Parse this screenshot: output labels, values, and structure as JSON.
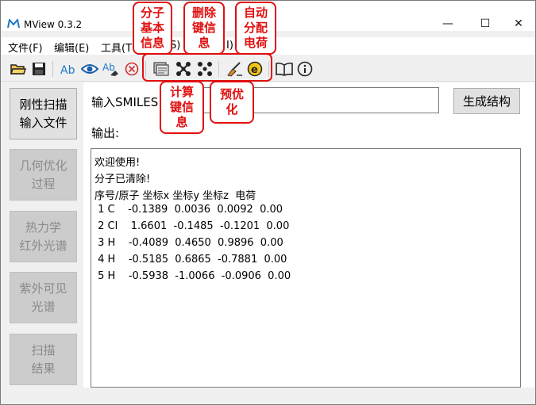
{
  "window": {
    "title": "MView 0.3.2"
  },
  "window_controls": {
    "minimize": "—",
    "maximize": "☐",
    "close": "✕"
  },
  "menu": [
    {
      "label": "文件(F)"
    },
    {
      "label": "编辑(E)"
    },
    {
      "label": "工具(T"
    },
    {
      "label": "S)"
    },
    {
      "label": "I)"
    }
  ],
  "toolbar": {
    "icons": [
      "open-folder-icon",
      "save-icon",
      "atom-label-icon",
      "view-eye-icon",
      "erase-label-icon",
      "clear-icon",
      "molecule-info-icon",
      "delete-bond-info-icon",
      "bond-calc-icon",
      "preoptimize-icon",
      "auto-charge-icon",
      "manual-book-icon",
      "info-icon"
    ]
  },
  "annotations": {
    "molecule_info": "分子\n基本\n信息",
    "delete_bond": "删除\n键信\n息",
    "auto_charge": "自动\n分配\n电荷",
    "calc_bond": "计算\n键信\n息",
    "preoptimize": "预优\n化"
  },
  "sidebar": {
    "buttons": [
      {
        "label": "刚性扫描\n输入文件",
        "enabled": true
      },
      {
        "label": "几何优化\n过程",
        "enabled": false
      },
      {
        "label": "热力学\n红外光谱",
        "enabled": false
      },
      {
        "label": "紫外可见\n光谱",
        "enabled": false
      },
      {
        "label": "扫描\n结果",
        "enabled": false
      }
    ]
  },
  "smiles": {
    "label": "输入SMILES",
    "partial": "C",
    "value": ""
  },
  "generate_button": "生成结构",
  "output": {
    "label": "输出:",
    "lines": [
      "欢迎使用!",
      "分子已清除!",
      "序号/原子 坐标x 坐标y 坐标z  电荷",
      " 1 C    -0.1389  0.0036  0.0092  0.00",
      " 2 Cl    1.6601  -0.1485  -0.1201  0.00",
      " 3 H    -0.4089  0.4650  0.9896  0.00",
      " 4 H    -0.5185  0.6865  -0.7881  0.00",
      " 5 H    -0.5938  -1.0066  -0.0906  0.00"
    ]
  }
}
